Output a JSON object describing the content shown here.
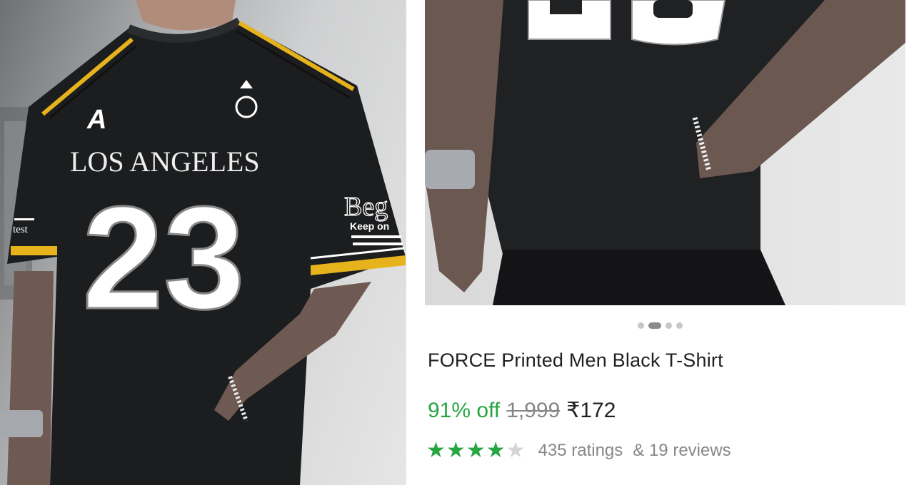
{
  "product": {
    "title": "FORCE Printed Men Black T-Shirt",
    "discount": "91% off",
    "mrp": "1,999",
    "price": "₹172",
    "rating": 4,
    "rating_max": 5,
    "ratings_count": "435 ratings",
    "reviews_count": "& 19 reviews"
  },
  "gallery": {
    "image_count": 4,
    "active_index": 1
  },
  "shirt_print": {
    "city": "LOS ANGELES",
    "number": "23",
    "logo": "A",
    "sleeve_word": "Beg",
    "sleeve_tag": "Keep on",
    "left_sleeve": "test"
  },
  "colors": {
    "discount_green": "#26a541",
    "star_green": "#26a541",
    "muted_gray": "#878787",
    "shirt_black": "#1c1d1f",
    "stripe_yellow": "#e6b31c"
  }
}
